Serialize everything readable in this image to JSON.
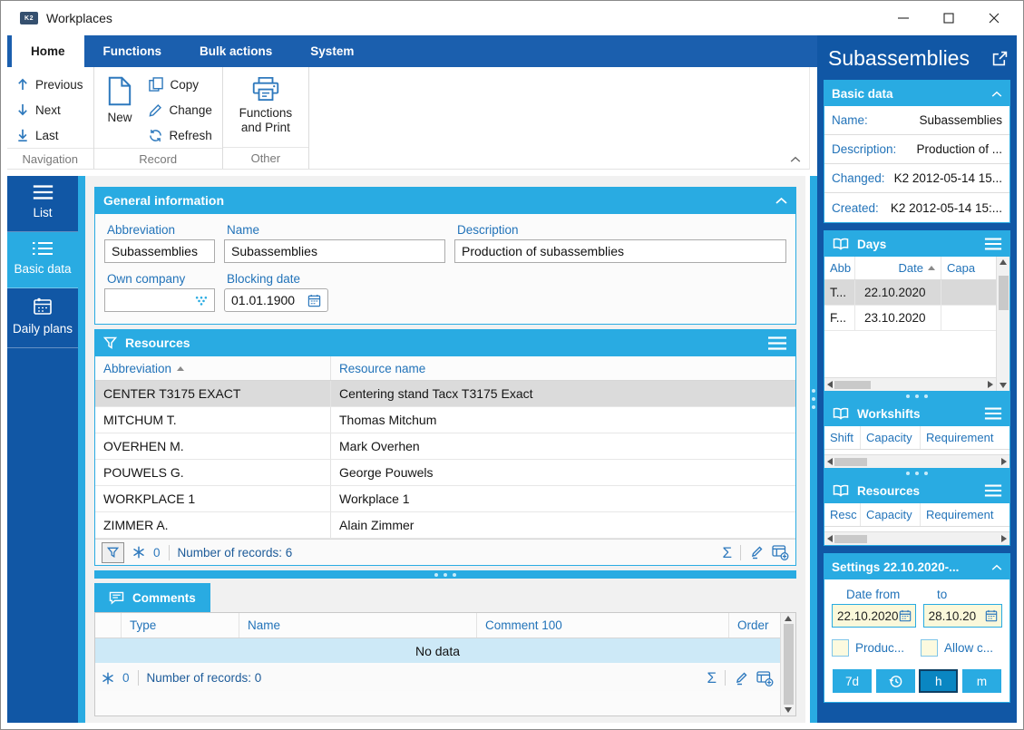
{
  "window": {
    "title": "Workplaces",
    "logo_text": "K2"
  },
  "ribbon": {
    "tabs": [
      "Home",
      "Functions",
      "Bulk actions",
      "System"
    ],
    "active_tab": "Home",
    "navigation": {
      "label": "Navigation",
      "previous": "Previous",
      "next": "Next",
      "last": "Last"
    },
    "record": {
      "label": "Record",
      "new": "New",
      "copy": "Copy",
      "change": "Change",
      "refresh": "Refresh"
    },
    "other": {
      "label": "Other",
      "functions_and_print": "Functions and Print"
    }
  },
  "sidebar": {
    "list": "List",
    "basic_data": "Basic data",
    "daily_plans": "Daily plans"
  },
  "general_info": {
    "title": "General information",
    "abbreviation_label": "Abbreviation",
    "abbreviation_value": "Subassemblies",
    "name_label": "Name",
    "name_value": "Subassemblies",
    "description_label": "Description",
    "description_value": "Production of subassemblies",
    "own_company_label": "Own company",
    "own_company_value": "",
    "blocking_date_label": "Blocking date",
    "blocking_date_value": "01.01.1900"
  },
  "resources_table": {
    "title": "Resources",
    "col_abbreviation": "Abbreviation",
    "col_resource_name": "Resource name",
    "rows": [
      {
        "abbr": "CENTER T3175 EXACT",
        "name": "Centering stand Tacx T3175 Exact"
      },
      {
        "abbr": "MITCHUM T.",
        "name": "Thomas Mitchum"
      },
      {
        "abbr": "OVERHEN M.",
        "name": "Mark Overhen"
      },
      {
        "abbr": "POUWELS G.",
        "name": "George Pouwels"
      },
      {
        "abbr": "WORKPLACE 1",
        "name": "Workplace 1"
      },
      {
        "abbr": "ZIMMER A.",
        "name": "Alain Zimmer"
      }
    ],
    "selected_row": "CENTER T3175 EXACT",
    "flag_count": "0",
    "records_text": "Number of records: 6"
  },
  "comments": {
    "tab": "Comments",
    "col_type": "Type",
    "col_name": "Name",
    "col_comment": "Comment 100",
    "col_order": "Order",
    "no_data": "No data",
    "flag_count": "0",
    "records_text": "Number of records: 0"
  },
  "right_panel": {
    "title": "Subassemblies",
    "basic_data": {
      "title": "Basic data",
      "name_label": "Name:",
      "name_value": "Subassemblies",
      "description_label": "Description:",
      "description_value": "Production of ...",
      "changed_label": "Changed:",
      "changed_value": "K2 2012-05-14 15...",
      "created_label": "Created:",
      "created_value": "K2 2012-05-14 15:..."
    },
    "days": {
      "title": "Days",
      "col_abb": "Abb",
      "col_date": "Date",
      "col_capacity": "Capa",
      "rows": [
        {
          "abb": "T...",
          "date": "22.10.2020"
        },
        {
          "abb": "F...",
          "date": "23.10.2020"
        }
      ],
      "selected_row": "22.10.2020"
    },
    "workshifts": {
      "title": "Workshifts",
      "col_shift": "Shift",
      "col_capacity": "Capacity",
      "col_requirement": "Requirement"
    },
    "resources": {
      "title": "Resources",
      "col_resource": "Resc",
      "col_capacity": "Capacity",
      "col_requirement": "Requirement"
    },
    "settings": {
      "title": "Settings 22.10.2020-...",
      "date_from_label": "Date from",
      "date_from_value": "22.10.2020",
      "date_to_label": "to",
      "date_to_value": "28.10.20",
      "checkbox1_label": "Produc...",
      "checkbox2_label": "Allow c...",
      "btn_7d": "7d",
      "btn_h": "h",
      "btn_m": "m"
    }
  },
  "icons": {
    "sum": "Σ"
  },
  "colors": {
    "accent_cyan": "#29ABE2",
    "dark_blue": "#1157A5",
    "label_blue": "#2273B9",
    "selected_row": "#DBDBDB",
    "no_data_bg": "#CDE9F7",
    "input_yellow": "#FBF8DA"
  }
}
